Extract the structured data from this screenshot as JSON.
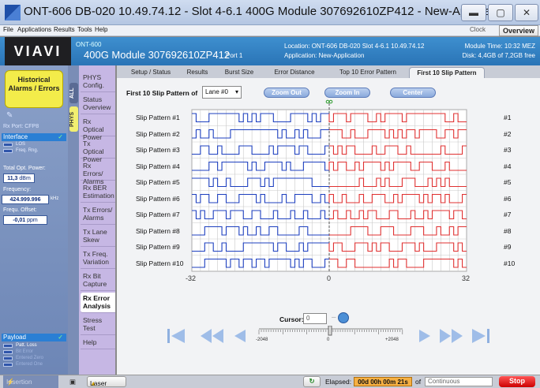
{
  "window": {
    "title": "ONT-606  DB-020 10.49.74.12 - Slot 4-6.1 400G Module 307692610ZP412 - New-Application",
    "buttons": [
      "minimize-icon",
      "maximize-icon",
      "close-icon"
    ]
  },
  "menu": {
    "items": [
      "File",
      "Applications",
      "Results",
      "Tools",
      "Help"
    ],
    "clock": "Clock",
    "overview": "Overview"
  },
  "header": {
    "logo": "VIAVI",
    "device": "ONT-600",
    "module": "400G Module 307692610ZP412",
    "port": "Port 1",
    "location": "Location: ONT-606 DB-020 Slot 4-6.1  10.49.74.12",
    "application": "Application: New-Application",
    "module_time": "Module Time: 10:32 MEZ",
    "disk": "Disk: 4,4GB of 7,2GB free"
  },
  "left": {
    "historical": "Historical Alarms / Errors",
    "rx_port": "Rx Port: CFP8",
    "interface": "Interface",
    "los": "LOS",
    "freq_rng": "Freq. Rng.",
    "total_opt_power_lbl": "Total Opt. Power:",
    "total_opt_power_val": "11,3",
    "total_opt_power_unit": "dBm",
    "frequency_lbl": "Frequency:",
    "frequency_val": "424.999.996",
    "frequency_unit": "kHz",
    "freq_offset_lbl": "Frequ. Offset:",
    "freq_offset_val": "-0,01",
    "freq_offset_unit": "ppm",
    "payload": "Payload",
    "payload_items": [
      "Patt. Loss",
      "Bit Error",
      "Entered Zero",
      "Entered One"
    ],
    "insertion": "Insertion"
  },
  "vtabs": [
    "ALL",
    "PHYS"
  ],
  "nav": [
    "PHYS Config.",
    "Status Overview",
    "Rx Optical Power",
    "Tx Optical Power",
    "Rx Errors/ Alarms",
    "Rx BER Estimation",
    "Tx Errors/ Alarms",
    "Tx Lane Skew",
    "Tx Freq. Variation",
    "Rx Bit Capture",
    "Rx Error Analysis",
    "Stress Test",
    "Help"
  ],
  "tabs": [
    "Setup / Status",
    "Results",
    "Burst Size",
    "Error Distance",
    "Top 10 Error Pattern",
    "First 10 Slip Pattern"
  ],
  "slip": {
    "title": "First 10 Slip Pattern of",
    "lane": "Lane #0",
    "zoom_out": "Zoom Out",
    "zoom_in": "Zoom In",
    "center": "Center",
    "rows": [
      "Slip Pattern  #1",
      "Slip Pattern  #2",
      "Slip Pattern  #3",
      "Slip Pattern  #4",
      "Slip Pattern  #5",
      "Slip Pattern  #6",
      "Slip Pattern  #7",
      "Slip Pattern  #8",
      "Slip Pattern  #9",
      "Slip Pattern #10"
    ],
    "rows_right": [
      "#1",
      "#2",
      "#3",
      "#4",
      "#5",
      "#6",
      "#7",
      "#8",
      "#9",
      "#10"
    ],
    "axis_left": "-32",
    "axis_mid": "0",
    "axis_right": "32",
    "cursor_label": "Cursor:",
    "cursor_value": "0",
    "slider_left": "-2048",
    "slider_mid": "0",
    "slider_right": "+2048"
  },
  "bottom": {
    "laser": "Laser",
    "elapsed_label": "Elapsed:",
    "elapsed": "00d 00h 00m 21s",
    "of": "of",
    "mode": "Continuous",
    "stop": "Stop"
  },
  "colors": {
    "before": "#1d3fbf",
    "after": "#e03030",
    "accent": "#2a74b6"
  }
}
